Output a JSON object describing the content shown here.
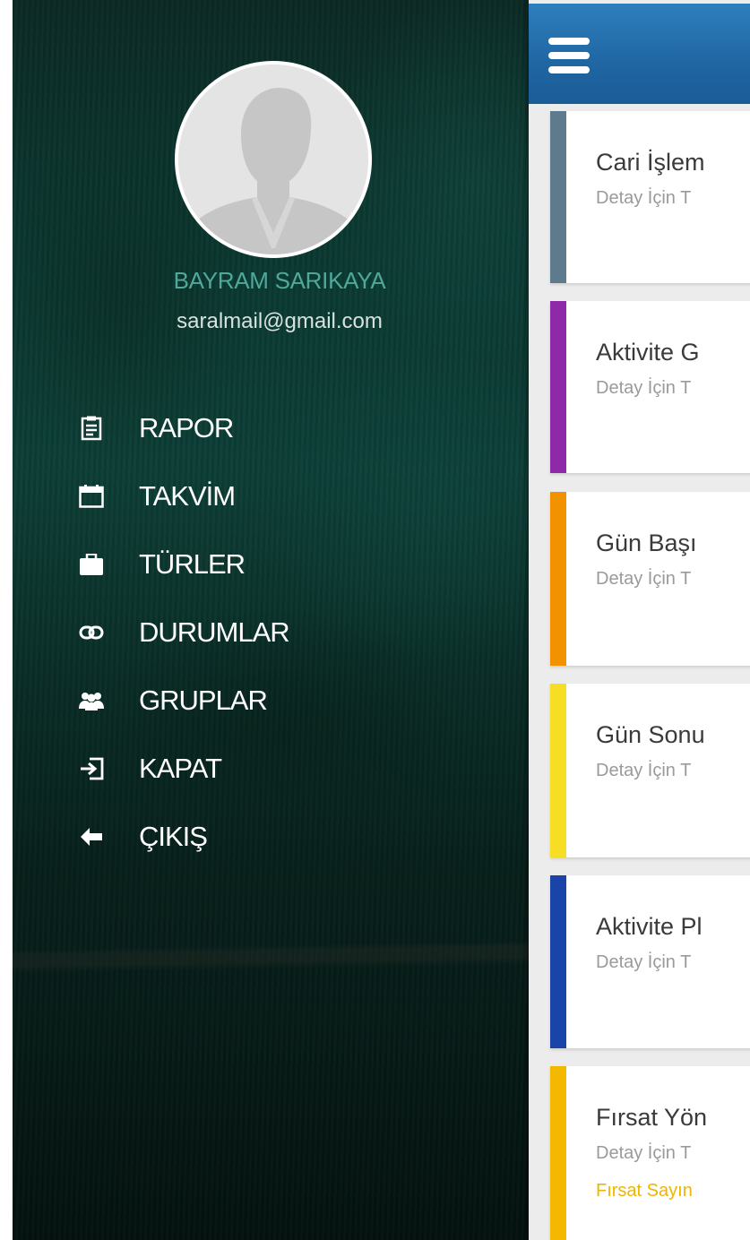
{
  "user": {
    "name": "BAYRAM SARIKAYA",
    "email": "saralmail@gmail.com"
  },
  "menu": [
    {
      "label": "RAPOR",
      "icon": "report-icon"
    },
    {
      "label": "TAKVİM",
      "icon": "calendar-icon"
    },
    {
      "label": "TÜRLER",
      "icon": "briefcase-icon"
    },
    {
      "label": "DURUMLAR",
      "icon": "link-icon"
    },
    {
      "label": "GRUPLAR",
      "icon": "group-icon"
    },
    {
      "label": "KAPAT",
      "icon": "sign-in-icon"
    },
    {
      "label": "ÇIKIŞ",
      "icon": "arrow-left-icon"
    }
  ],
  "header": {
    "menu_icon": "hamburger-icon"
  },
  "cards": [
    {
      "title": "Cari İşlem",
      "subtitle": "Detay İçin T",
      "color": "#5d7b8c"
    },
    {
      "title": "Aktivite G",
      "subtitle": "Detay İçin T",
      "color": "#8e2aa8"
    },
    {
      "title": "Gün Başı",
      "subtitle": "Detay İçin T",
      "color": "#f39200"
    },
    {
      "title": "Gün Sonu",
      "subtitle": "Detay İçin T",
      "color": "#f6de25"
    },
    {
      "title": "Aktivite Pl",
      "subtitle": "Detay İçin T",
      "color": "#1b44a8"
    },
    {
      "title": "Fırsat Yön",
      "subtitle": "Detay İçin T",
      "extra": "Fırsat Sayın",
      "color": "#f5b800"
    }
  ],
  "colors": {
    "accent_blue": "#1f66a3",
    "name_teal": "#4fa89a"
  }
}
